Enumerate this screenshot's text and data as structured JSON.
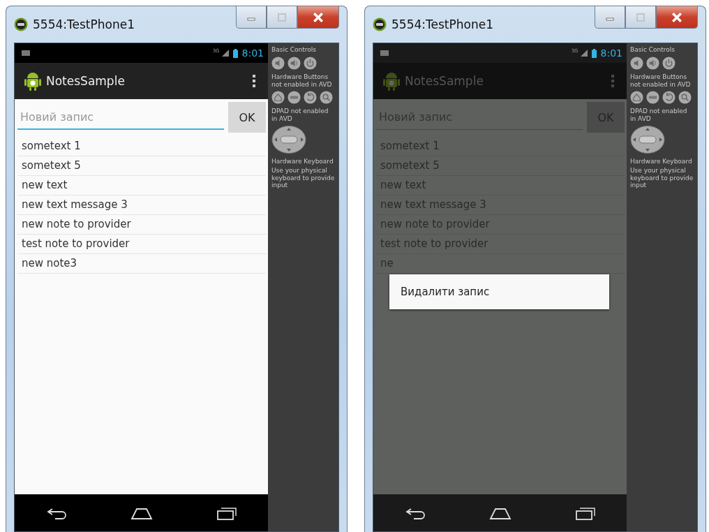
{
  "windows": [
    {
      "title": "5554:TestPhone1",
      "dimmed": false,
      "status": {
        "network": "3G",
        "time": "8:01"
      },
      "app_title": "NotesSample",
      "input": {
        "placeholder": "Новий запис",
        "focused": true
      },
      "ok_label": "OK",
      "notes": [
        "sometext 1",
        "sometext 5",
        "new text",
        "new text message 3",
        "new note to provider",
        "test note to provider",
        "new note3"
      ],
      "panel": {
        "basic": "Basic Controls",
        "hardware": "Hardware Buttons not enabled in AVD",
        "dpad": "DPAD not enabled in AVD",
        "keyboard": "Hardware Keyboard",
        "keyboard_hint": "Use your physical keyboard to provide input"
      }
    },
    {
      "title": "5554:TestPhone1",
      "dimmed": true,
      "status": {
        "network": "3G",
        "time": "8:01"
      },
      "app_title": "NotesSample",
      "input": {
        "placeholder": "Новий запис",
        "focused": false
      },
      "ok_label": "OK",
      "notes": [
        "sometext 1",
        "sometext 5",
        "new text",
        "new text message 3",
        "new note to provider",
        "test note to provider",
        "ne"
      ],
      "dialog_items": [
        "Видалити запис"
      ],
      "panel": {
        "basic": "Basic Controls",
        "hardware": "Hardware Buttons not enabled in AVD",
        "dpad": "DPAD not enabled in AVD",
        "keyboard": "Hardware Keyboard",
        "keyboard_hint": "Use your physical keyboard to provide input"
      }
    }
  ]
}
